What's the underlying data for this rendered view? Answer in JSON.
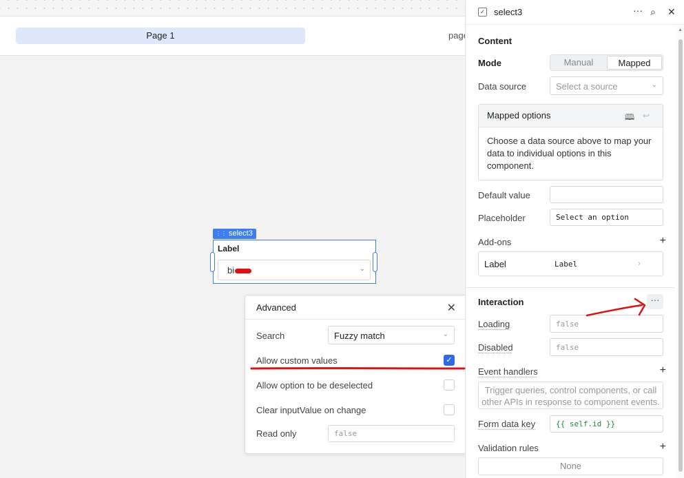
{
  "canvas": {
    "page_tab": "Page 1",
    "page_right_text": "page",
    "component": {
      "tag": "select3",
      "label": "Label",
      "value": "bi"
    }
  },
  "advanced": {
    "title": "Advanced",
    "search_label": "Search",
    "search_value": "Fuzzy match",
    "allow_custom_label": "Allow custom values",
    "allow_custom_checked": true,
    "deselect_label": "Allow option to be deselected",
    "clear_label": "Clear inputValue on change",
    "readonly_label": "Read only",
    "readonly_placeholder": "false"
  },
  "panel": {
    "title": "select3",
    "content_section": "Content",
    "mode_label": "Mode",
    "mode_options": [
      "Manual",
      "Mapped"
    ],
    "mode_selected": "Mapped",
    "data_source_label": "Data source",
    "data_source_placeholder": "Select a source",
    "mapped_options_title": "Mapped options",
    "mapped_options_body": "Choose a data source above to map your data to individual options in this component.",
    "default_value_label": "Default value",
    "placeholder_label": "Placeholder",
    "placeholder_value": "Select an option",
    "addons_label": "Add-ons",
    "addon_name": "Label",
    "addon_value": "Label",
    "interaction_section": "Interaction",
    "loading_label": "Loading",
    "loading_placeholder": "false",
    "disabled_label": "Disabled",
    "disabled_placeholder": "false",
    "event_handlers_label": "Event handlers",
    "event_handlers_hint": "Trigger queries, control components, or call other APIs in response to component events.",
    "form_data_key_label": "Form data key",
    "form_data_key_value": "{{ self.id }}",
    "validation_label": "Validation rules",
    "validation_value": "None"
  },
  "colors": {
    "accent": "#3e7ef0",
    "annotation": "#e01010",
    "checkbox_on": "#2f6be8",
    "code_green": "#1a8a3a"
  },
  "icons": [
    "checkbox-icon",
    "more-icon",
    "search-icon",
    "close-icon",
    "chevron-down-icon",
    "book-icon",
    "return-icon",
    "plus-icon",
    "chevron-right-icon",
    "checkmark-icon",
    "grip-icon"
  ]
}
